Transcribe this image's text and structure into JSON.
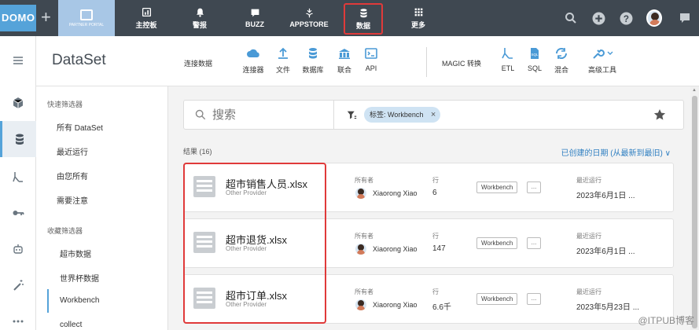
{
  "topnav": {
    "logo": "DOMO",
    "plus": "+",
    "partner_portal": "PARTNER PORTAL",
    "items": [
      {
        "label": "主控板",
        "icon": "dashboard-icon"
      },
      {
        "label": "警报",
        "icon": "bell-icon"
      },
      {
        "label": "BUZZ",
        "icon": "chat-icon"
      },
      {
        "label": "APPSTORE",
        "icon": "appstore-icon"
      },
      {
        "label": "数据",
        "icon": "database-icon"
      },
      {
        "label": "更多",
        "icon": "grid-icon"
      }
    ],
    "active_item": "数据",
    "right_icons": [
      "search-icon",
      "plus-circle-icon",
      "help-icon",
      "avatar",
      "chat-icon"
    ]
  },
  "rail": {
    "items": [
      "menu-icon",
      "cube-icon",
      "database-icon",
      "etl-icon",
      "key-icon",
      "robot-icon",
      "wand-icon",
      "more-icon"
    ],
    "active": "database-icon"
  },
  "header": {
    "title": "DataSet",
    "connect_label": "连接数据",
    "connect_tools": [
      {
        "label": "连接器",
        "icon": "cloud-icon"
      },
      {
        "label": "文件",
        "icon": "upload-icon"
      },
      {
        "label": "数据库",
        "icon": "database-icon"
      },
      {
        "label": "联合",
        "icon": "federated-icon"
      },
      {
        "label": "API",
        "icon": "terminal-icon"
      }
    ],
    "magic_label": "MAGIC 转换",
    "magic_tools": [
      {
        "label": "ETL",
        "icon": "etl-icon"
      },
      {
        "label": "SQL",
        "icon": "sql-icon"
      },
      {
        "label": "混合",
        "icon": "blend-icon"
      },
      {
        "label": "高级工具",
        "icon": "wrench-icon"
      }
    ]
  },
  "filters": {
    "quick_header": "快速筛选器",
    "quick_items": [
      "所有 DataSet",
      "最近运行",
      "由您所有",
      "需要注意"
    ],
    "fav_header": "收藏筛选器",
    "fav_items": [
      "超市数据",
      "世界杯数据",
      "Workbench",
      "collect"
    ],
    "selected": "Workbench"
  },
  "search": {
    "placeholder": "搜索",
    "tag": "标签: Workbench",
    "tag_close": "×"
  },
  "results": {
    "label": "结果 (16)",
    "sort": "已创建的日期 (从最新到最旧) ∨"
  },
  "card_labels": {
    "owner": "所有者",
    "rows": "行",
    "last_run": "最近运行",
    "more": "..."
  },
  "datasets": [
    {
      "name": "超市销售人员.xlsx",
      "provider": "Other Provider",
      "owner": "Xiaorong Xiao",
      "rows": "6",
      "tag": "Workbench",
      "last_run": "2023年6月1日 ..."
    },
    {
      "name": "超市退货.xlsx",
      "provider": "Other Provider",
      "owner": "Xiaorong Xiao",
      "rows": "147",
      "tag": "Workbench",
      "last_run": "2023年6月1日 ..."
    },
    {
      "name": "超市订单.xlsx",
      "provider": "Other Provider",
      "owner": "Xiaorong Xiao",
      "rows": "6.6千",
      "tag": "Workbench",
      "last_run": "2023年5月23日 ..."
    }
  ],
  "watermark": "@ITPUB博客",
  "colors": {
    "nav_bg": "#3f4851",
    "accent": "#55a3d9",
    "highlight": "#e03a3a",
    "tag_bg": "#cfe3f3"
  }
}
